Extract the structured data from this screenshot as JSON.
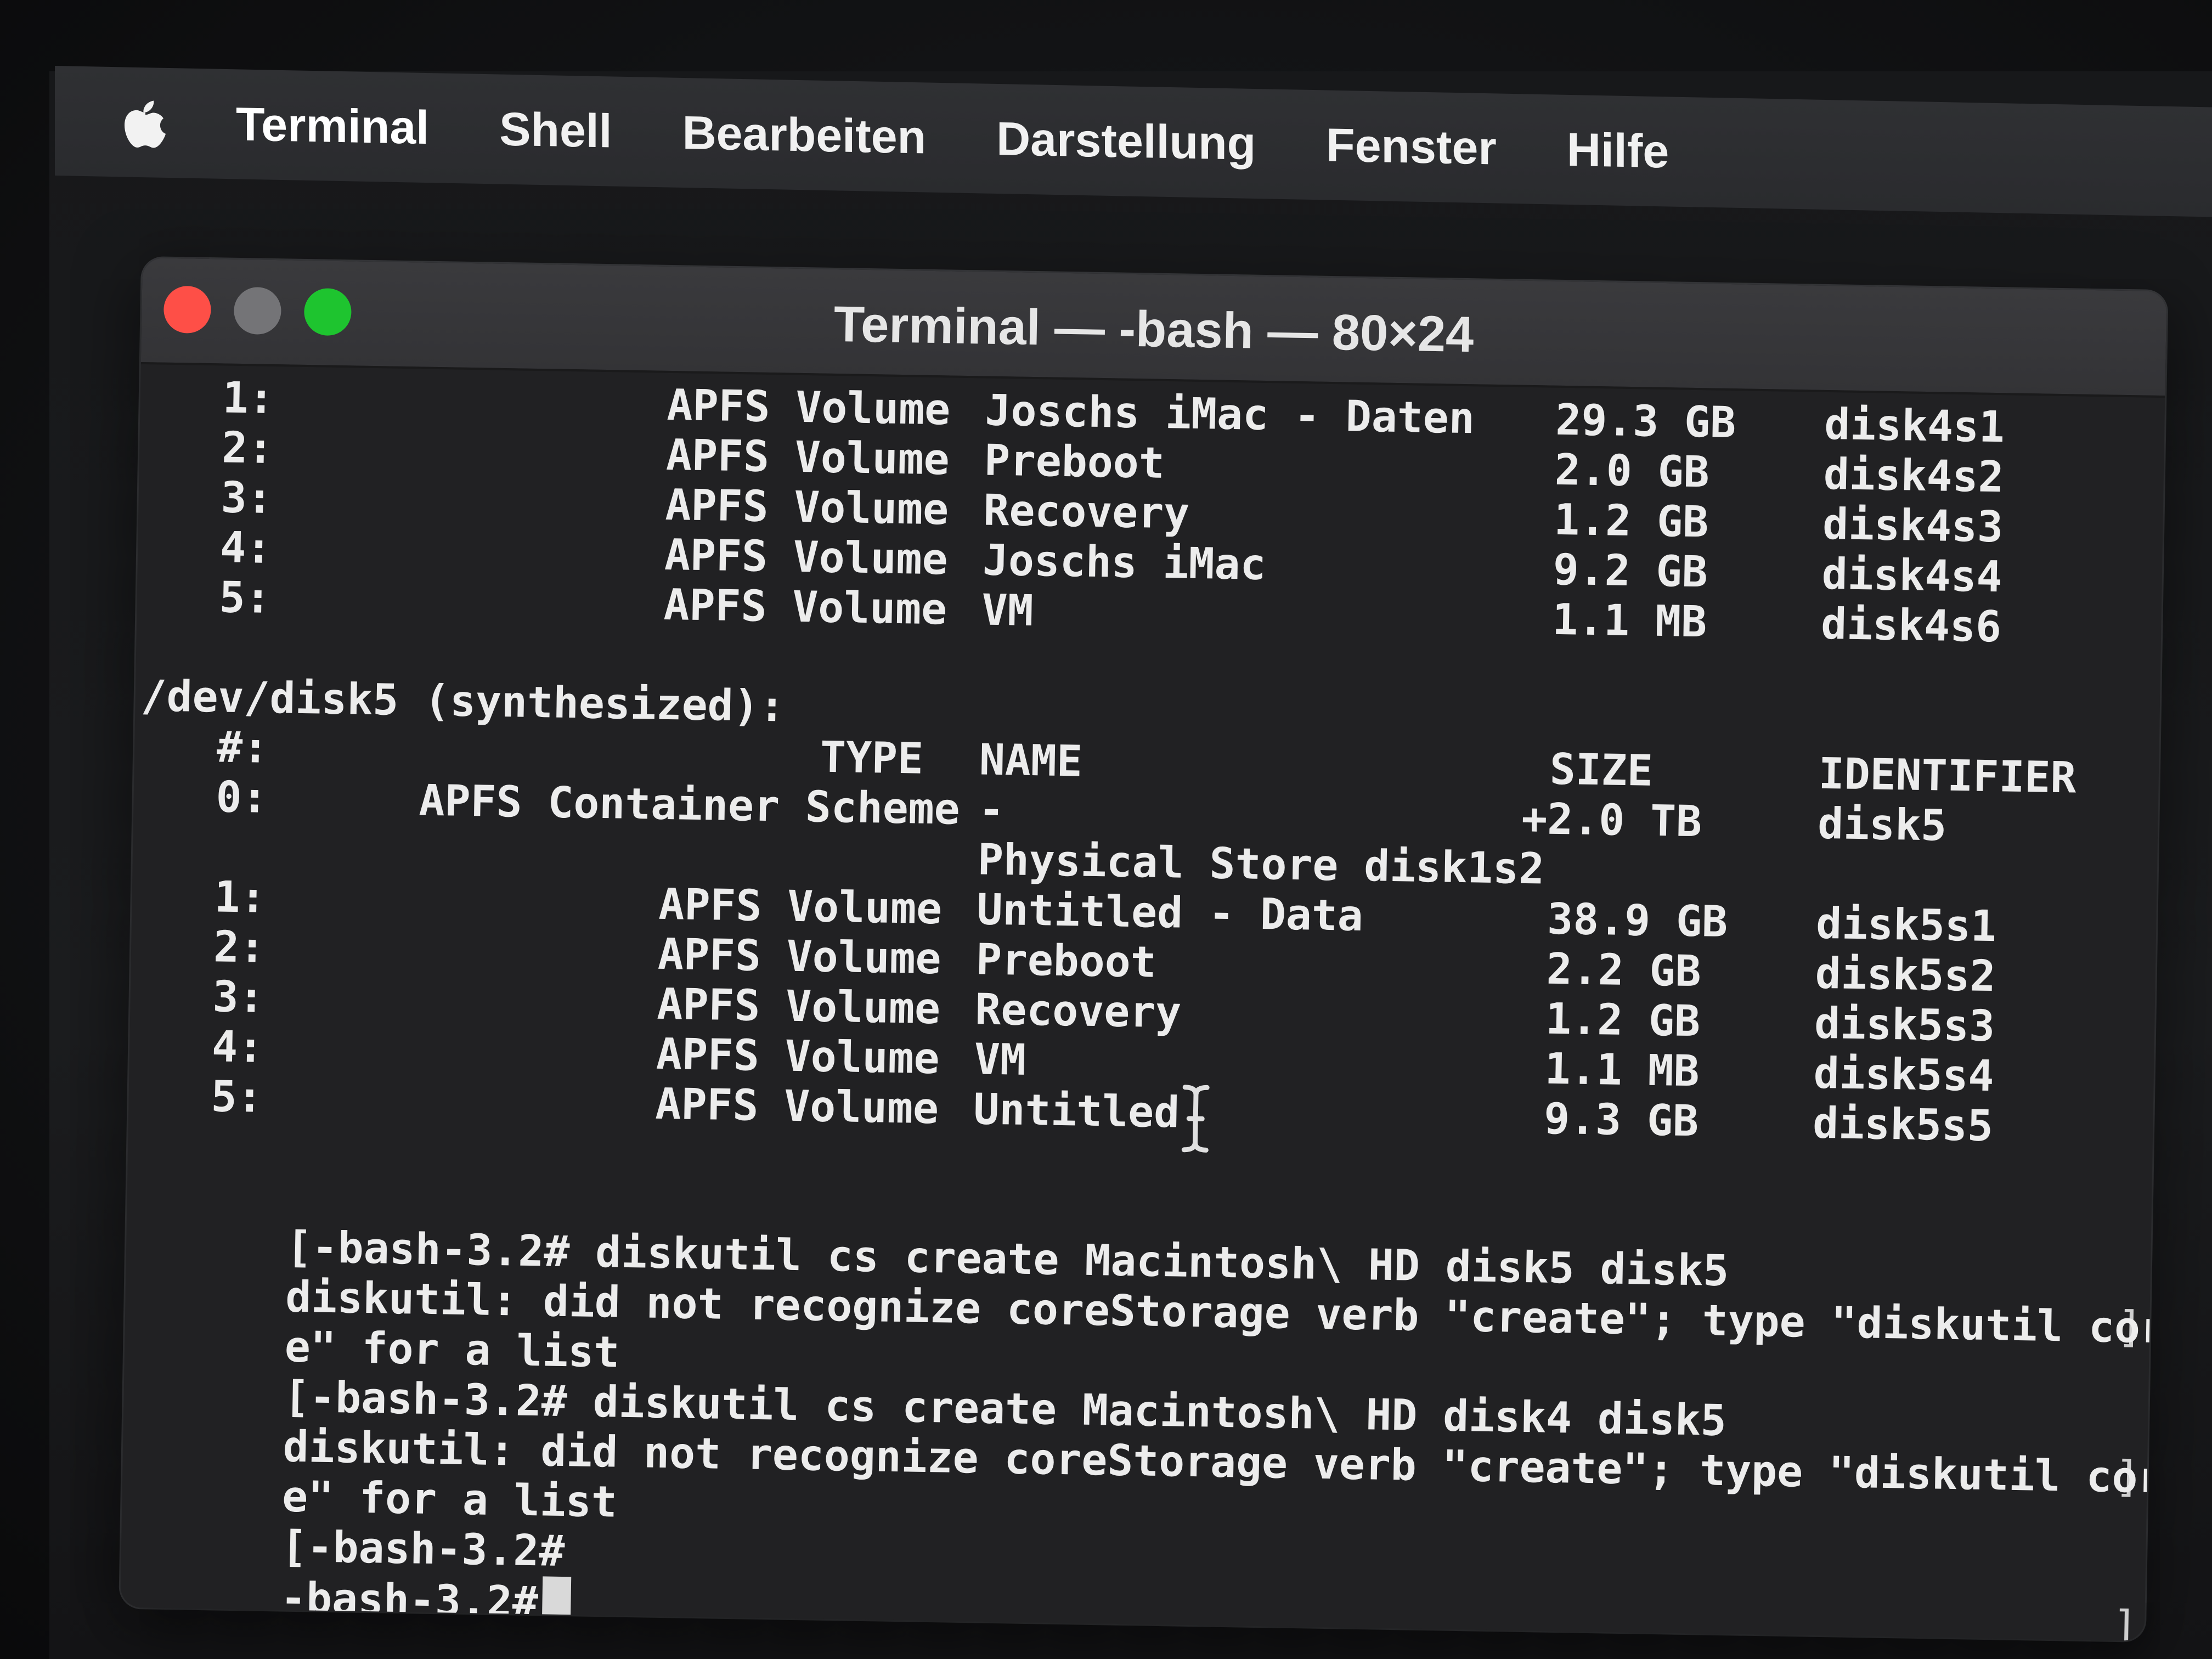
{
  "menubar": {
    "apple_icon": "apple-logo-icon",
    "items": [
      "Terminal",
      "Shell",
      "Bearbeiten",
      "Darstellung",
      "Fenster",
      "Hilfe"
    ]
  },
  "window": {
    "title": "Terminal — -bash — 80×24",
    "colors": {
      "close": "#fe4f47",
      "minimize": "#747477",
      "zoom": "#1ec42f"
    }
  },
  "disk4_partitions": [
    {
      "index": "1:",
      "type": "APFS Volume",
      "name": "Joschs iMac - Daten",
      "size": "29.3 GB",
      "id": "disk4s1"
    },
    {
      "index": "2:",
      "type": "APFS Volume",
      "name": "Preboot",
      "size": "2.0 GB",
      "id": "disk4s2"
    },
    {
      "index": "3:",
      "type": "APFS Volume",
      "name": "Recovery",
      "size": "1.2 GB",
      "id": "disk4s3"
    },
    {
      "index": "4:",
      "type": "APFS Volume",
      "name": "Joschs iMac",
      "size": "9.2 GB",
      "id": "disk4s4"
    },
    {
      "index": "5:",
      "type": "APFS Volume",
      "name": "VM",
      "size": "1.1 MB",
      "id": "disk4s6"
    }
  ],
  "disk5": {
    "header": "/dev/disk5 (synthesized):",
    "columns": {
      "index": "#:",
      "type": "TYPE",
      "name": "NAME",
      "size": "SIZE",
      "id": "IDENTIFIER"
    },
    "container": {
      "index": "0:",
      "type": "APFS Container Scheme",
      "name": "-",
      "size": "+2.0 TB",
      "id": "disk5"
    },
    "physical_store": "Physical Store disk1s2",
    "partitions": [
      {
        "index": "1:",
        "type": "APFS Volume",
        "name": "Untitled - Data",
        "size": "38.9 GB",
        "id": "disk5s1"
      },
      {
        "index": "2:",
        "type": "APFS Volume",
        "name": "Preboot",
        "size": "2.2 GB",
        "id": "disk5s2"
      },
      {
        "index": "3:",
        "type": "APFS Volume",
        "name": "Recovery",
        "size": "1.2 GB",
        "id": "disk5s3"
      },
      {
        "index": "4:",
        "type": "APFS Volume",
        "name": "VM",
        "size": "1.1 MB",
        "id": "disk5s4"
      },
      {
        "index": "5:",
        "type": "APFS Volume",
        "name": "Untitled",
        "size": "9.3 GB",
        "id": "disk5s5"
      }
    ]
  },
  "session": [
    {
      "kind": "prompt",
      "text": "[-bash-3.2# diskutil cs create Macintosh\\ HD disk5 disk5",
      "bracket": "]"
    },
    {
      "kind": "output",
      "text": "diskutil: did not recognize coreStorage verb \"create\"; type \"diskutil coreStorag"
    },
    {
      "kind": "output",
      "text": "e\" for a list"
    },
    {
      "kind": "prompt",
      "text": "[-bash-3.2# diskutil cs create Macintosh\\ HD disk4 disk5",
      "bracket": "]"
    },
    {
      "kind": "output",
      "text": "diskutil: did not recognize coreStorage verb \"create\"; type \"diskutil coreStorag"
    },
    {
      "kind": "output",
      "text": "e\" for a list"
    },
    {
      "kind": "prompt",
      "text": "[-bash-3.2#",
      "bracket": "]"
    }
  ],
  "current_prompt": "-bash-3.2#"
}
